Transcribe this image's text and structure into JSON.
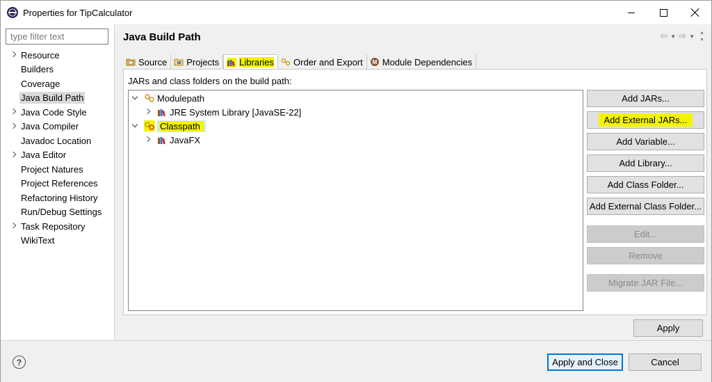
{
  "window": {
    "title": "Properties for TipCalculator"
  },
  "nav": {
    "filter_placeholder": "type filter text",
    "items": [
      {
        "label": "Resource",
        "expandable": true
      },
      {
        "label": "Builders",
        "expandable": false
      },
      {
        "label": "Coverage",
        "expandable": false
      },
      {
        "label": "Java Build Path",
        "expandable": false,
        "selected": true
      },
      {
        "label": "Java Code Style",
        "expandable": true
      },
      {
        "label": "Java Compiler",
        "expandable": true
      },
      {
        "label": "Javadoc Location",
        "expandable": false
      },
      {
        "label": "Java Editor",
        "expandable": true
      },
      {
        "label": "Project Natures",
        "expandable": false
      },
      {
        "label": "Project References",
        "expandable": false
      },
      {
        "label": "Refactoring History",
        "expandable": false
      },
      {
        "label": "Run/Debug Settings",
        "expandable": false
      },
      {
        "label": "Task Repository",
        "expandable": true
      },
      {
        "label": "WikiText",
        "expandable": false
      }
    ]
  },
  "page": {
    "title": "Java Build Path",
    "tabs": [
      {
        "label": "Source",
        "icon": "source-folder-icon"
      },
      {
        "label": "Projects",
        "icon": "projects-icon"
      },
      {
        "label": "Libraries",
        "icon": "libraries-icon",
        "active": true
      },
      {
        "label": "Order and Export",
        "icon": "order-export-icon"
      },
      {
        "label": "Module Dependencies",
        "icon": "module-dependencies-icon"
      }
    ],
    "panel_label": "JARs and class folders on the build path:",
    "tree": {
      "modulepath": "Modulepath",
      "jre": "JRE System Library [JavaSE-22]",
      "classpath": "Classpath",
      "javafx": "JavaFX"
    },
    "buttons": {
      "add_jars": "Add JARs...",
      "add_external_jars": "Add External JARs...",
      "add_variable": "Add Variable...",
      "add_library": "Add Library...",
      "add_class_folder": "Add Class Folder...",
      "add_external_class_folder": "Add External Class Folder...",
      "edit": "Edit...",
      "remove": "Remove",
      "migrate_jar": "Migrate JAR File..."
    },
    "apply": "Apply"
  },
  "footer": {
    "help": "?",
    "apply_close": "Apply and Close",
    "cancel": "Cancel"
  },
  "colors": {
    "highlight": "#f4f400",
    "selection": "#cde8ff",
    "accent": "#0078d7"
  }
}
